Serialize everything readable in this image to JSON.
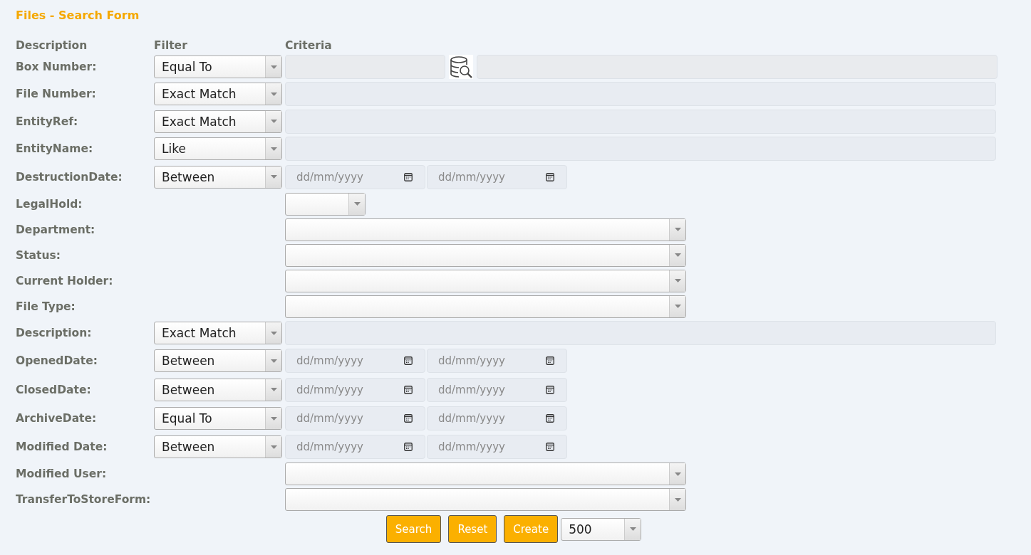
{
  "title": "Files - Search Form",
  "headers": [
    "Description",
    "Filter",
    "Criteria"
  ],
  "rows": [
    {
      "kind": "lookup",
      "label": "Box Number:",
      "filter": "Equal To"
    },
    {
      "kind": "text",
      "label": "File Number:",
      "filter": "Exact Match"
    },
    {
      "kind": "text",
      "label": "EntityRef:",
      "filter": "Exact Match"
    },
    {
      "kind": "text",
      "label": "EntityName:",
      "filter": "Like"
    },
    {
      "kind": "date",
      "label": "DestructionDate:",
      "filter": "Between",
      "placeholders": [
        "dd/mm/yyyy",
        "dd/mm/yyyy"
      ]
    },
    {
      "kind": "small-select",
      "label": "LegalHold:"
    },
    {
      "kind": "select",
      "label": "Department:"
    },
    {
      "kind": "select",
      "label": "Status:"
    },
    {
      "kind": "select",
      "label": "Current Holder:"
    },
    {
      "kind": "select",
      "label": "File Type:"
    },
    {
      "kind": "text",
      "label": "Description:",
      "filter": "Exact Match"
    },
    {
      "kind": "date",
      "label": "OpenedDate:",
      "filter": "Between",
      "placeholders": [
        "dd/mm/yyyy",
        "dd/mm/yyyy"
      ]
    },
    {
      "kind": "date",
      "label": "ClosedDate:",
      "filter": "Between",
      "placeholders": [
        "dd/mm/yyyy",
        "dd/mm/yyyy"
      ]
    },
    {
      "kind": "date",
      "label": "ArchiveDate:",
      "filter": "Equal To",
      "placeholders": [
        "dd/mm/yyyy",
        "dd/mm/yyyy"
      ]
    },
    {
      "kind": "date",
      "label": "Modified Date:",
      "filter": "Between",
      "placeholders": [
        "dd/mm/yyyy",
        "dd/mm/yyyy"
      ]
    },
    {
      "kind": "select",
      "label": "Modified User:"
    },
    {
      "kind": "select",
      "label": "TransferToStoreForm:"
    }
  ],
  "buttons": [
    "Search",
    "Reset",
    "Create"
  ],
  "page_size": "500"
}
